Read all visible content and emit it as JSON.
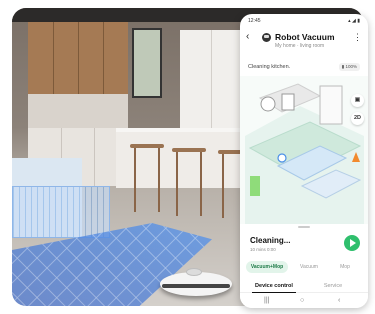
{
  "phone": {
    "status": {
      "time": "12:45",
      "icons": "▴ ◢ ▮"
    },
    "header": {
      "title": "Robot Vacuum",
      "subtitle": "My home · living room",
      "back_icon": "chevron-left-icon",
      "more_icon": "more-vertical-icon"
    },
    "clean_status": "Cleaning kitchen.",
    "battery": "▮ 100%",
    "map_buttons": [
      {
        "label": "▣",
        "icon": "map-layers-icon"
      },
      {
        "label": "2D"
      }
    ],
    "bottom": {
      "title": "Cleaning...",
      "subtitle": "10 mins 0:00",
      "play_icon": "play-icon",
      "modes": [
        {
          "label": "Vacuum+Mop",
          "active": true
        },
        {
          "label": "Vacuum",
          "active": false
        },
        {
          "label": "Mop",
          "active": false
        }
      ],
      "tabs": [
        {
          "label": "Device control",
          "active": true
        },
        {
          "label": "Service",
          "active": false
        }
      ]
    },
    "nav": {
      "recent": "|||",
      "home": "○",
      "back": "‹"
    }
  },
  "colors": {
    "accent_green": "#2fbf6d",
    "scan_blue": "#4a8fe8"
  }
}
